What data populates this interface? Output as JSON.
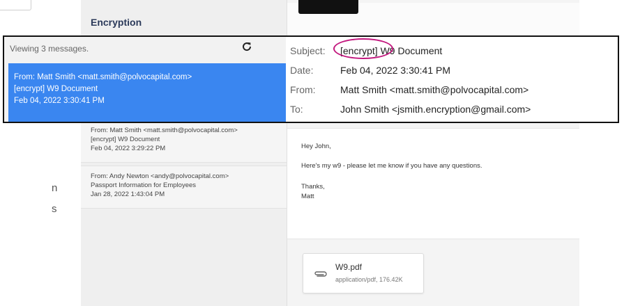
{
  "app": {
    "title": "Encryption"
  },
  "left_fragments": [
    "n",
    "s"
  ],
  "message_list": {
    "viewing_text": "Viewing 3 messages.",
    "selected": {
      "from": "From: Matt Smith <matt.smith@polvocapital.com>",
      "subject": "[encrypt] W9 Document",
      "date": "Feb 04, 2022 3:30:41 PM"
    },
    "items": [
      {
        "from": "From: Matt Smith <matt.smith@polvocapital.com>",
        "subject": "[encrypt] W9 Document",
        "date": "Feb 04, 2022 3:29:22 PM"
      },
      {
        "from": "From: Andy Newton <andy@polvocapital.com>",
        "subject": "Passport Information for Employees",
        "date": "Jan 28, 2022 1:43:04 PM"
      }
    ]
  },
  "header": {
    "subject_label": "Subject:",
    "subject_tag": "[encrypt]",
    "subject_rest": "W9 Document",
    "date_label": "Date:",
    "date_value": "Feb 04, 2022 3:30:41 PM",
    "from_label": "From:",
    "from_value": "Matt Smith <matt.smith@polvocapital.com>",
    "to_label": "To:",
    "to_value": "John Smith <jsmith.encryption@gmail.com>"
  },
  "body": {
    "greeting": "Hey John,",
    "line1": "Here's my w9 - please let me know if you have any questions.",
    "closing": "Thanks,",
    "signature": "Matt"
  },
  "attachment": {
    "name": "W9.pdf",
    "meta": "application/pdf, 176.42K",
    "icon": "paperclip-icon"
  },
  "colors": {
    "selected_bg": "#3a86f0",
    "annotation": "#c2187e"
  }
}
